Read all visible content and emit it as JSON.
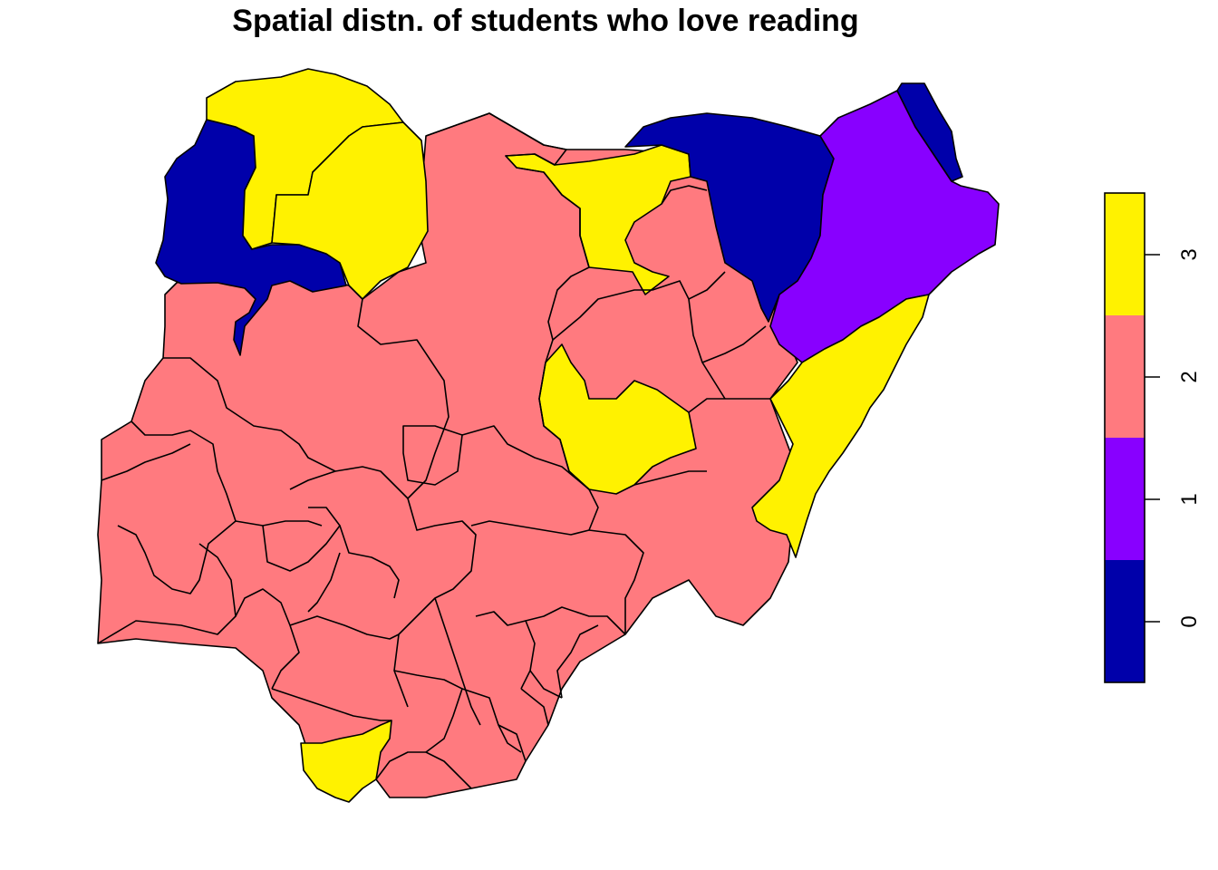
{
  "title": "Spatial distn. of students who love reading",
  "palette": {
    "0": "#0000AA",
    "1": "#8800FF",
    "2": "#FF7A7F",
    "3": "#FFF200"
  },
  "legend": {
    "ticks": [
      "0",
      "1",
      "2",
      "3"
    ],
    "colors": [
      "#0000AA",
      "#8800FF",
      "#FF7A7F",
      "#FFF200"
    ]
  },
  "map": {
    "regions": [
      {
        "id": "sokoto",
        "value": 0
      },
      {
        "id": "zamfara",
        "value": 3
      },
      {
        "id": "katsina",
        "value": 3
      },
      {
        "id": "kebbi",
        "value": 0
      },
      {
        "id": "kano",
        "value": 2
      },
      {
        "id": "jigawa",
        "value": 3
      },
      {
        "id": "yobe",
        "value": 0
      },
      {
        "id": "borno",
        "value": 1
      },
      {
        "id": "borno-ne",
        "value": 0
      },
      {
        "id": "adamawa",
        "value": 3
      },
      {
        "id": "plateau",
        "value": 3
      },
      {
        "id": "bayelsa",
        "value": 3
      },
      {
        "id": "niger",
        "value": 2
      },
      {
        "id": "kaduna",
        "value": 2
      },
      {
        "id": "bauchi",
        "value": 2
      },
      {
        "id": "gombe",
        "value": 2
      },
      {
        "id": "taraba",
        "value": 2
      },
      {
        "id": "kwara",
        "value": 2
      },
      {
        "id": "oyo",
        "value": 2
      },
      {
        "id": "ogun",
        "value": 2
      },
      {
        "id": "lagos",
        "value": 2
      },
      {
        "id": "osun",
        "value": 2
      },
      {
        "id": "ekiti",
        "value": 2
      },
      {
        "id": "ondo",
        "value": 2
      },
      {
        "id": "kogi",
        "value": 2
      },
      {
        "id": "abuja",
        "value": 2
      },
      {
        "id": "nasarawa",
        "value": 2
      },
      {
        "id": "benue",
        "value": 2
      },
      {
        "id": "edo",
        "value": 2
      },
      {
        "id": "delta",
        "value": 2
      },
      {
        "id": "anambra",
        "value": 2
      },
      {
        "id": "enugu",
        "value": 2
      },
      {
        "id": "ebonyi",
        "value": 2
      },
      {
        "id": "cross-river",
        "value": 2
      },
      {
        "id": "imo",
        "value": 2
      },
      {
        "id": "abia",
        "value": 2
      },
      {
        "id": "rivers",
        "value": 2
      },
      {
        "id": "akwa-ibom",
        "value": 2
      }
    ]
  }
}
